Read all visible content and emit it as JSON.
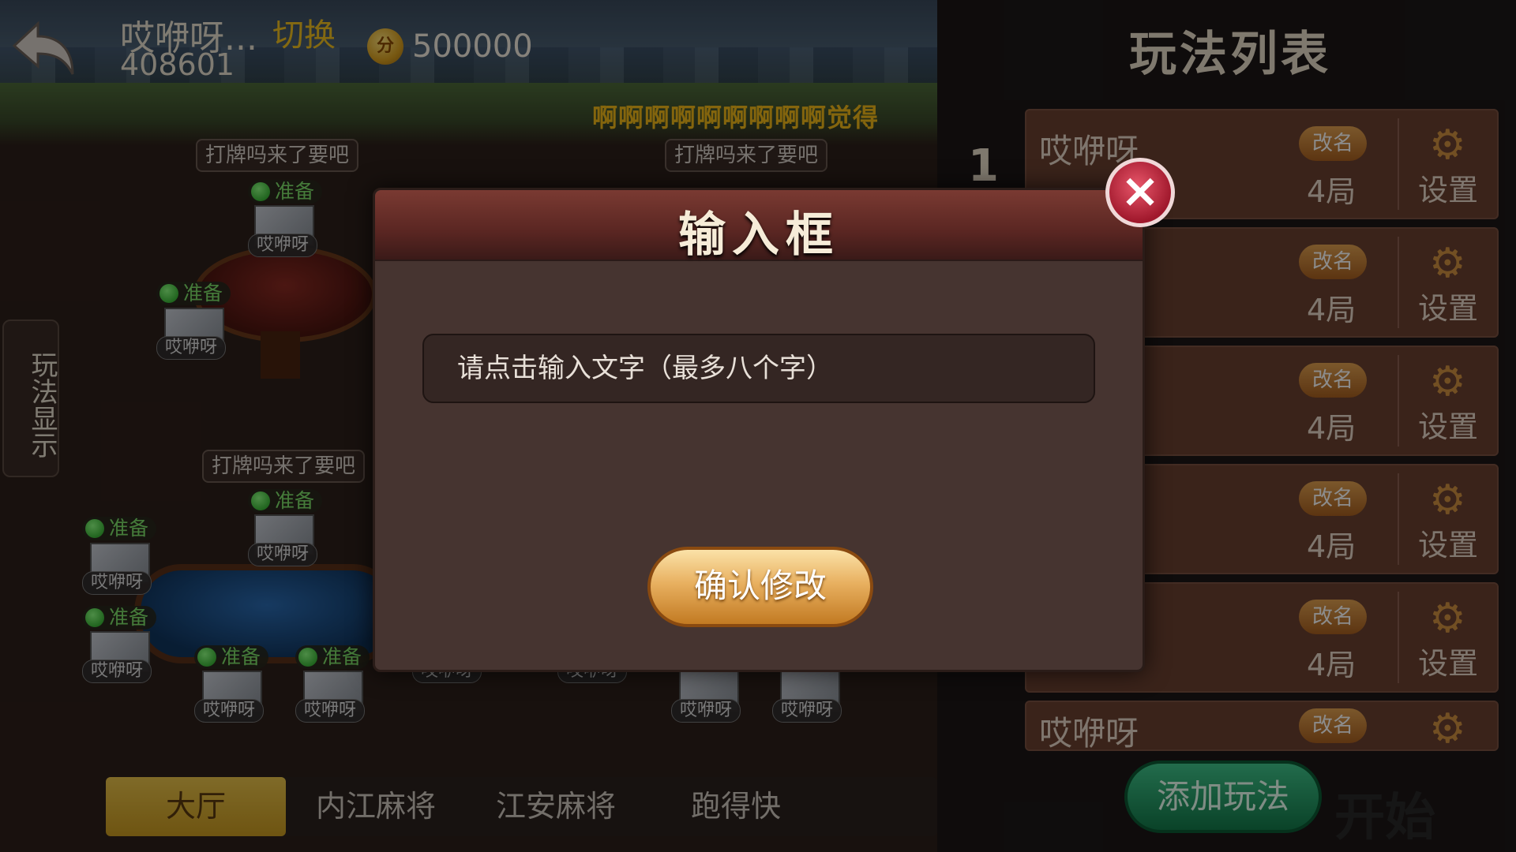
{
  "header": {
    "nickname": "哎咿呀...",
    "switch_label": "切换",
    "user_id": "408601",
    "coin_icon_text": "分",
    "score": "500000",
    "marquee": "啊啊啊啊啊啊啊啊啊觉得"
  },
  "lobby": {
    "table_title": "打牌吗来了要吧",
    "ready_label": "准备",
    "player_name": "哎咿呀",
    "side_tab": "玩法显示"
  },
  "bottom_tabs": [
    "大厅",
    "内江麻将",
    "江安麻将",
    "跑得快"
  ],
  "panel": {
    "title": "玩法列表",
    "index_label": "1",
    "rename_label": "改名",
    "settings_label": "设置",
    "cards": [
      {
        "name": "哎咿呀",
        "rounds": "4局"
      },
      {
        "name": "",
        "rounds": "4局"
      },
      {
        "name": "",
        "rounds": "4局"
      },
      {
        "name": "",
        "rounds": "4局"
      },
      {
        "name": "",
        "rounds": "4局"
      },
      {
        "name": "哎咿呀",
        "rounds": ""
      }
    ],
    "add_button": "添加玩法",
    "start_label": "开始"
  },
  "modal": {
    "title": "输入框",
    "placeholder": "请点击输入文字（最多八个字）",
    "confirm_button": "确认修改",
    "close_symbol": "×"
  },
  "colors": {
    "accent_gold": "#f0c020",
    "ready_green": "#7ee06a",
    "confirm_orange": "#e8b060",
    "close_red": "#a0182c",
    "add_green": "#3fc48a"
  }
}
